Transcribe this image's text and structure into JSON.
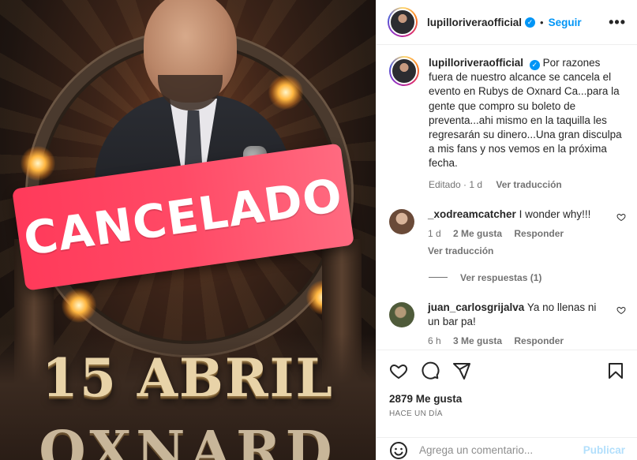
{
  "post_image": {
    "banner_text": "CANCELADO",
    "date_text": "15 ABRIL",
    "city_text": "OXNARD"
  },
  "header": {
    "username": "lupilloriveraofficial",
    "separator": "•",
    "follow_label": "Seguir",
    "more_label": "•••"
  },
  "caption": {
    "username": "lupilloriveraofficial",
    "text": "Por razones fuera de nuestro alcance se cancela el evento en Rubys de Oxnard Ca...para la gente que compro su boleto de preventa...ahi mismo en la taquilla les regresarán su dinero...Una gran disculpa a mis fans y nos vemos en la próxima fecha.",
    "edited": "Editado · 1 d",
    "translate": "Ver traducción"
  },
  "comments": [
    {
      "username": "_xodreamcatcher",
      "text": "I wonder why!!!",
      "time": "1 d",
      "likes": "2 Me gusta",
      "reply": "Responder",
      "translate": "Ver traducción",
      "replies": "Ver respuestas (1)"
    },
    {
      "username": "juan_carlosgrijalva",
      "text": "Ya no llenas ni un bar pa!",
      "time": "6 h",
      "likes": "3 Me gusta",
      "reply": "Responder"
    }
  ],
  "actions": {
    "icons": [
      "heart-icon",
      "comment-icon",
      "share-icon",
      "bookmark-icon"
    ],
    "likes": "2879 Me gusta",
    "posted": "HACE UN DÍA"
  },
  "add_comment": {
    "placeholder": "Agrega un comentario...",
    "publish_label": "Publicar"
  },
  "colors": {
    "accent": "#0095f6",
    "banner": "#ff4a66",
    "muted": "#737373"
  }
}
